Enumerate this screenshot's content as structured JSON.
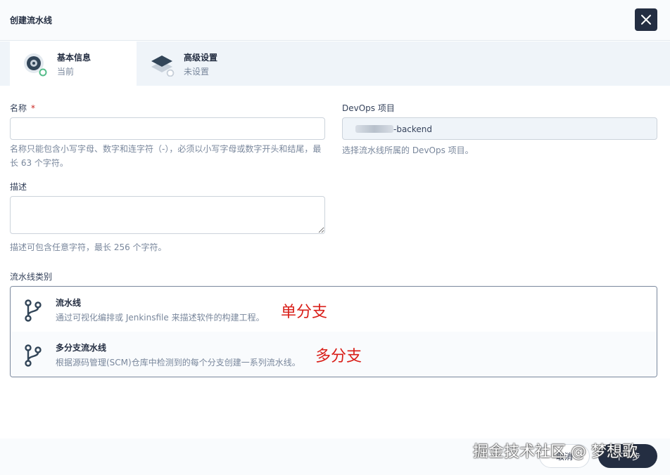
{
  "header": {
    "title": "创建流水线",
    "close_icon": "close-icon"
  },
  "steps": [
    {
      "title": "基本信息",
      "status": "当前",
      "icon": "disc-step-icon"
    },
    {
      "title": "高级设置",
      "status": "未设置",
      "icon": "layers-step-icon"
    }
  ],
  "form": {
    "name": {
      "label": "名称",
      "required_mark": "*",
      "value": "",
      "hint": "名称只能包含小写字母、数字和连字符（-），必须以小写字母或数字开头和结尾，最长 63 个字符。"
    },
    "description": {
      "label": "描述",
      "value": "",
      "hint": "描述可包含任意字符，最长 256 个字符。"
    },
    "project": {
      "label": "DevOps 项目",
      "value": "-backend",
      "hint": "选择流水线所属的 DevOps 项目。"
    },
    "pipeline_type": {
      "label": "流水线类别",
      "options": [
        {
          "title": "流水线",
          "desc": "通过可视化编排或 Jenkinsfile 来描述软件的构建工程。",
          "icon": "branch-icon",
          "annotation": "单分支"
        },
        {
          "title": "多分支流水线",
          "desc": "根据源码管理(SCM)仓库中检测到的每个分支创建一系列流水线。",
          "icon": "branch-icon",
          "annotation": "多分支"
        }
      ]
    }
  },
  "footer": {
    "cancel_label": "取消",
    "next_label": "下一步"
  },
  "watermark": "掘金技术社区 @ 梦想歌",
  "colors": {
    "primary_dark": "#242e42",
    "accent_green": "#55bc8a",
    "annotation_red": "#d91e18"
  }
}
